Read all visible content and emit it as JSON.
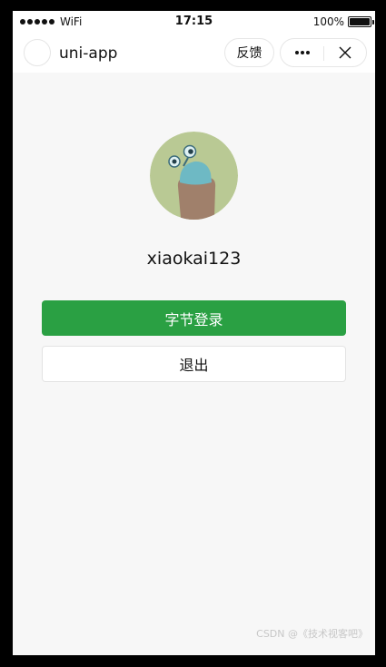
{
  "status_bar": {
    "carrier": "WiFi",
    "time": "17:15",
    "battery_percent": "100%",
    "battery_level": 1.0
  },
  "nav_bar": {
    "title": "uni-app",
    "feedback_label": "反馈",
    "more_icon": "more-dots-icon",
    "close_icon": "close-icon"
  },
  "profile": {
    "avatar_icon": "avatar-image",
    "username": "xiaokai123"
  },
  "actions": {
    "login_label": "字节登录",
    "logout_label": "退出"
  },
  "colors": {
    "primary": "#2aa043",
    "page_background": "#f7f7f7"
  },
  "watermark": "CSDN @《技术视客吧》"
}
